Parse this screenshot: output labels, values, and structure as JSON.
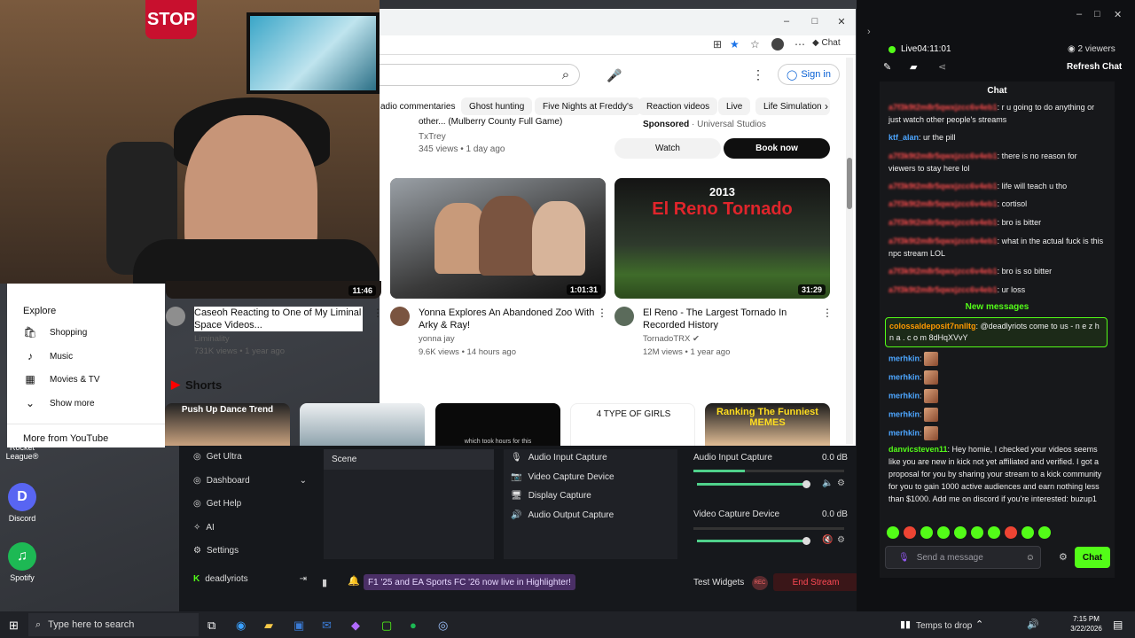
{
  "desktop": {
    "icons": [
      {
        "label": "Rocket League®",
        "glyph": "RL",
        "color": "#1b4f99"
      },
      {
        "label": "Discord",
        "glyph": "D",
        "color": "#5865f2"
      },
      {
        "label": "Spotify",
        "glyph": "♫",
        "color": "#1db954"
      }
    ]
  },
  "webcam": {
    "stop_sign": "STOP"
  },
  "browser": {
    "window_controls": {
      "min": "–",
      "max": "□",
      "close": "✕"
    },
    "toolbar_chat": "Chat",
    "youtube": {
      "signin": "Sign in",
      "chips": [
        "adio commentaries",
        "Ghost hunting",
        "Five Nights at Freddy's",
        "Reaction videos",
        "Live",
        "Life Simulation"
      ],
      "prev_row": {
        "left_title": "other... (Mulberry County Full Game)",
        "left_channel": "TxTrey",
        "left_meta": "345 views • 1 day ago",
        "right_sponsored": "Sponsored",
        "right_sponsor_name": "· Universal Studios",
        "watch_label": "Watch",
        "book_label": "Book now"
      },
      "videos": [
        {
          "title": "Caseoh Reacting to One of My Liminal Space Videos...",
          "channel": "Liminality",
          "meta": "731K views • 1 year ago",
          "duration": "11:46"
        },
        {
          "title": "Yonna Explores An Abandoned Zoo With Arky & Ray!",
          "channel": "yonna jay",
          "meta": "9.6K views • 14 hours ago",
          "duration": "1:01:31"
        },
        {
          "title": "El Reno - The Largest Tornado In Recorded History",
          "channel": "TornadoTRX",
          "meta": "12M views • 1 year ago",
          "duration": "31:29",
          "thumb_year": "2013",
          "thumb_text": "El Reno Tornado"
        }
      ],
      "shorts": {
        "title": "Shorts",
        "items": [
          {
            "text": "Push Up Dance Trend"
          },
          {
            "text": ""
          },
          {
            "text": "which took hours for this"
          },
          {
            "text": "4 TYPE OF GIRLS"
          },
          {
            "text": "Ranking The Funniest MEMES"
          }
        ]
      },
      "sidebar": {
        "explore": "Explore",
        "items": [
          {
            "label": "Shopping",
            "icon": "🛍"
          },
          {
            "label": "Music",
            "icon": "♪"
          },
          {
            "label": "Movies & TV",
            "icon": "▦"
          },
          {
            "label": "Show more",
            "icon": "⌄"
          }
        ],
        "more_from": "More from YouTube"
      }
    }
  },
  "app": {
    "nav": [
      {
        "label": "Get Ultra",
        "icon": "◎"
      },
      {
        "label": "Dashboard",
        "icon": "◎"
      },
      {
        "label": "Get Help",
        "icon": "◎"
      },
      {
        "label": "AI",
        "icon": "✧"
      },
      {
        "label": "Settings",
        "icon": "⚙"
      },
      {
        "label": "deadlyriots",
        "icon": "K"
      }
    ],
    "scene_header": "Scene",
    "sources": [
      {
        "label": "Audio Input Capture",
        "icon": "🎙"
      },
      {
        "label": "Video Capture Device",
        "icon": "📷"
      },
      {
        "label": "Display Capture",
        "icon": "🖥"
      },
      {
        "label": "Audio Output Capture",
        "icon": "🔊"
      }
    ],
    "mixer": [
      {
        "label": "Audio Input Capture",
        "db": "0.0 dB",
        "level": 0.34
      },
      {
        "label": "Video Capture Device",
        "db": "0.0 dB",
        "level": 0.0
      }
    ],
    "promo": "F1 '25 and EA Sports FC '26 now live in Highlighter!",
    "test_widgets": "Test Widgets",
    "rec_badge": "REC",
    "end_stream": "End Stream"
  },
  "chat": {
    "window_controls": {
      "min": "–",
      "max": "□",
      "close": "✕"
    },
    "live": "Live",
    "live_time": "04:11:01",
    "viewers": "2 viewers",
    "refresh": "Refresh Chat",
    "title": "Chat",
    "messages": [
      {
        "user": "a7f3k9t2m8r5qwxjzcc6v4eb1",
        "text": ": r u going to do anything or just watch other people's streams",
        "color": "#ff4d4d"
      },
      {
        "user": "ktf_alan",
        "text": ": ur the pill",
        "color": "#4da6ff"
      },
      {
        "user": "a7f3k9t2m8r5qwxjzcc6v4eb1",
        "text": ": there is no reason for viewers to stay here lol",
        "color": "#ff4d4d"
      },
      {
        "user": "a7f3k9t2m8r5qwxjzcc6v4eb1",
        "text": ": life will teach u tho",
        "color": "#ff4d4d"
      },
      {
        "user": "a7f3k9t2m8r5qwxjzcc6v4eb1",
        "text": ": cortisol",
        "color": "#ff4d4d"
      },
      {
        "user": "a7f3k9t2m8r5qwxjzcc6v4eb1",
        "text": ": bro is bitter",
        "color": "#ff4d4d"
      },
      {
        "user": "a7f3k9t2m8r5qwxjzcc6v4eb1",
        "text": ": what in the actual fuck is this npc stream LOL",
        "color": "#ff4d4d"
      },
      {
        "user": "a7f3k9t2m8r5qwxjzcc6v4eb1",
        "text": ": bro is so bitter",
        "color": "#ff4d4d"
      },
      {
        "user": "a7f3k9t2m8r5qwxjzcc6v4eb1",
        "text": ": ur loss",
        "color": "#ff4d4d"
      }
    ],
    "new_messages": "New messages",
    "highlight": {
      "user": "colossaldeposit7nnlltg",
      "text": ": @deadlyriots come to us - n e z h n a . c o m 8dHqXVvY",
      "color": "#ff9900"
    },
    "merhkin": {
      "user": "merhkin",
      "count": 5,
      "color": "#4da6ff"
    },
    "long": {
      "user": "danvicsteven11",
      "text": ": Hey homie, I checked your videos seems like you are new in kick not yet affiliated and verified. I got a proposal for you by sharing your stream to a kick community for you to gain 1000 active audiences and earn nothing less than $1000. Add me on discord if you're interested: buzup1",
      "color": "#53fc18"
    },
    "placeholder": "Send a message",
    "send": "Chat"
  },
  "taskbar": {
    "search": "Type here to search",
    "temps": "Temps to drop",
    "time": "7:15 PM",
    "date": "3/22/2026"
  }
}
